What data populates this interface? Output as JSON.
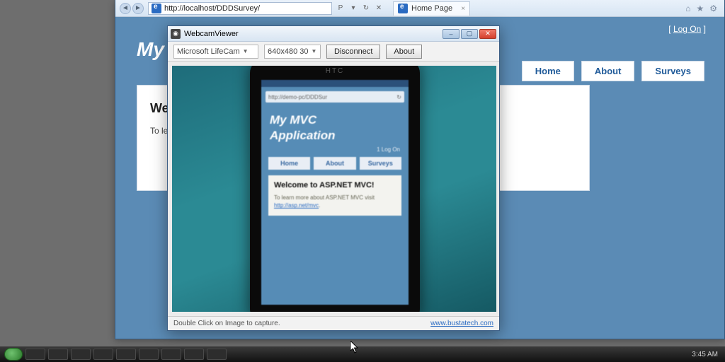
{
  "browser": {
    "url": "http://localhost/DDDSurvey/",
    "tab_title": "Home Page",
    "search_hint": "P",
    "logon": "Log On",
    "app_title": "My MVC Application",
    "tabs": {
      "home": "Home",
      "about": "About",
      "surveys": "Surveys"
    },
    "card_heading": "Welcome to ASP.NET MVC!",
    "card_body": "To learn more about ASP.NET MVC visit"
  },
  "webcam": {
    "title": "WebcamViewer",
    "camera_select": "Microsoft LifeCam",
    "res_select": "640x480 30",
    "disconnect": "Disconnect",
    "about": "About",
    "footer_hint": "Double Click on Image to capture.",
    "footer_link": "www.bustatech.com",
    "phone": {
      "brand": "HTC",
      "url": "http://demo-pc/DDDSur",
      "title_line1": "My MVC",
      "title_line2": "Application",
      "date": "1 Log On",
      "tab_home": "Home",
      "tab_about": "About",
      "tab_surveys": "Surveys",
      "card_heading": "Welcome to ASP.NET MVC!",
      "card_body": "To learn more about ASP.NET MVC visit",
      "card_link": "http://asp.net/mvc"
    }
  },
  "taskbar": {
    "clock": "3:45 AM"
  }
}
